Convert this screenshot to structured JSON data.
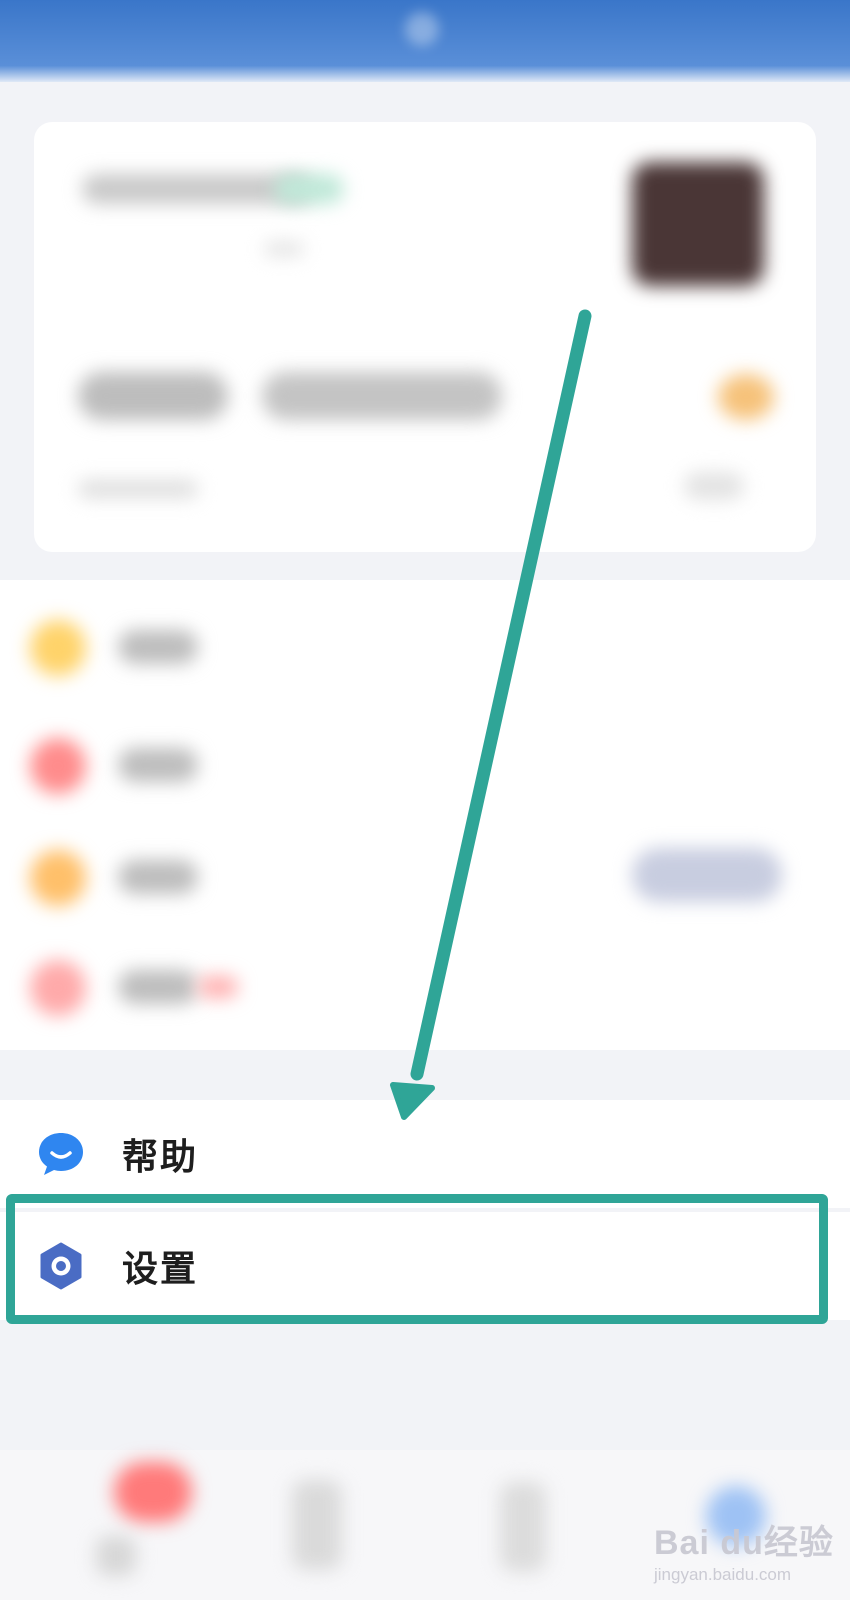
{
  "menu": {
    "help_label": "帮助",
    "settings_label": "设置"
  },
  "icons": {
    "help": "chat-bubble-smile-icon",
    "settings": "hexagon-gear-icon"
  },
  "colors": {
    "accent_blue": "#3a76c9",
    "highlight_teal": "#2fa597",
    "help_icon": "#2f86f0",
    "settings_icon": "#4a6cc4"
  },
  "watermark": {
    "brand": "Bai du经验",
    "domain": "jingyan.baidu.com"
  }
}
